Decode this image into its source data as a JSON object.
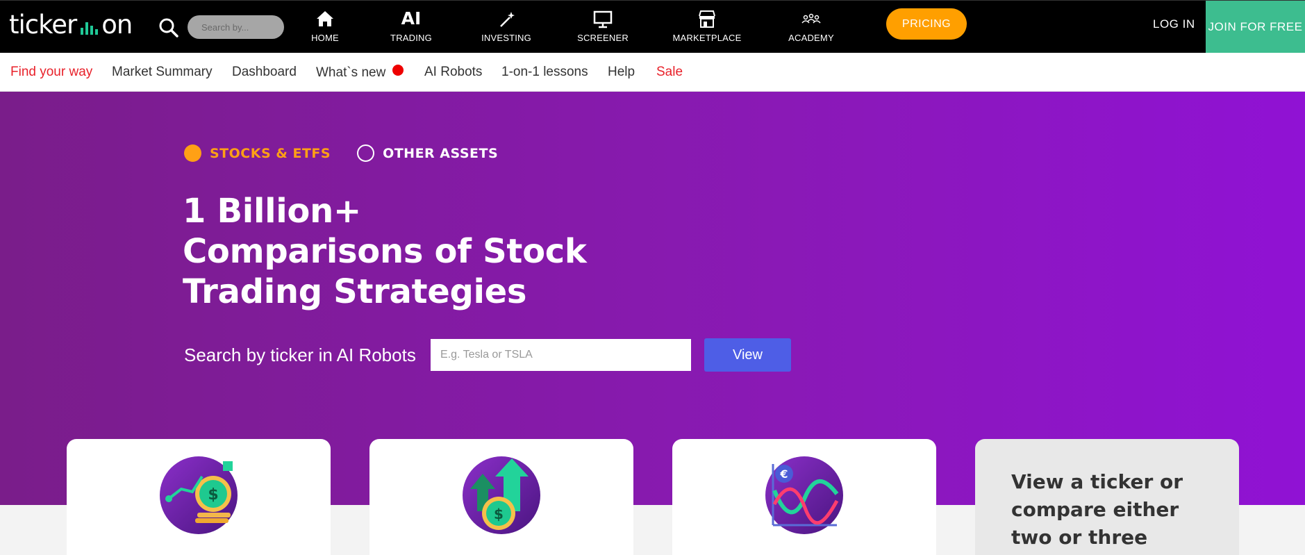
{
  "header": {
    "logo_left": "ticker",
    "logo_right": "on",
    "search_placeholder": "Search by...",
    "nav": [
      {
        "label": "HOME",
        "icon": "home-icon"
      },
      {
        "label": "TRADING",
        "icon": "ai-icon",
        "icon_text": "AI"
      },
      {
        "label": "INVESTING",
        "icon": "magic-wand-icon"
      },
      {
        "label": "SCREENER",
        "icon": "monitor-icon"
      },
      {
        "label": "MARKETPLACE",
        "icon": "store-icon"
      },
      {
        "label": "ACADEMY",
        "icon": "people-icon"
      }
    ],
    "pricing_label": "PRICING",
    "login_label": "LOG IN",
    "join_label": "JOIN FOR FREE"
  },
  "subnav": {
    "items": [
      {
        "label": "Find your way"
      },
      {
        "label": "Market Summary"
      },
      {
        "label": "Dashboard"
      },
      {
        "label": "What`s new"
      },
      {
        "label": "AI Robots"
      },
      {
        "label": "1-on-1 lessons"
      },
      {
        "label": "Help"
      },
      {
        "label": "Sale"
      }
    ]
  },
  "hero": {
    "asset_options": [
      {
        "label": "STOCKS & ETFS",
        "selected": true
      },
      {
        "label": "OTHER ASSETS",
        "selected": false
      }
    ],
    "headline_lines": [
      "1 Billion+",
      "Comparisons of Stock",
      "Trading Strategies"
    ],
    "search_label": "Search by ticker in AI Robots",
    "search_placeholder": "E.g. Tesla or TSLA",
    "view_label": "View"
  },
  "cards": {
    "icons": [
      "coins-growth-icon",
      "dollar-arrows-up-icon",
      "euro-chart-icon"
    ],
    "compare_text": "View a ticker or compare either two or three"
  },
  "colors": {
    "accent_orange": "#ff9f00",
    "join_green": "#3dbd8f",
    "view_blue": "#4e5ee6",
    "hero_purple": "#8a19b6",
    "subnav_red": "#e8212a"
  }
}
